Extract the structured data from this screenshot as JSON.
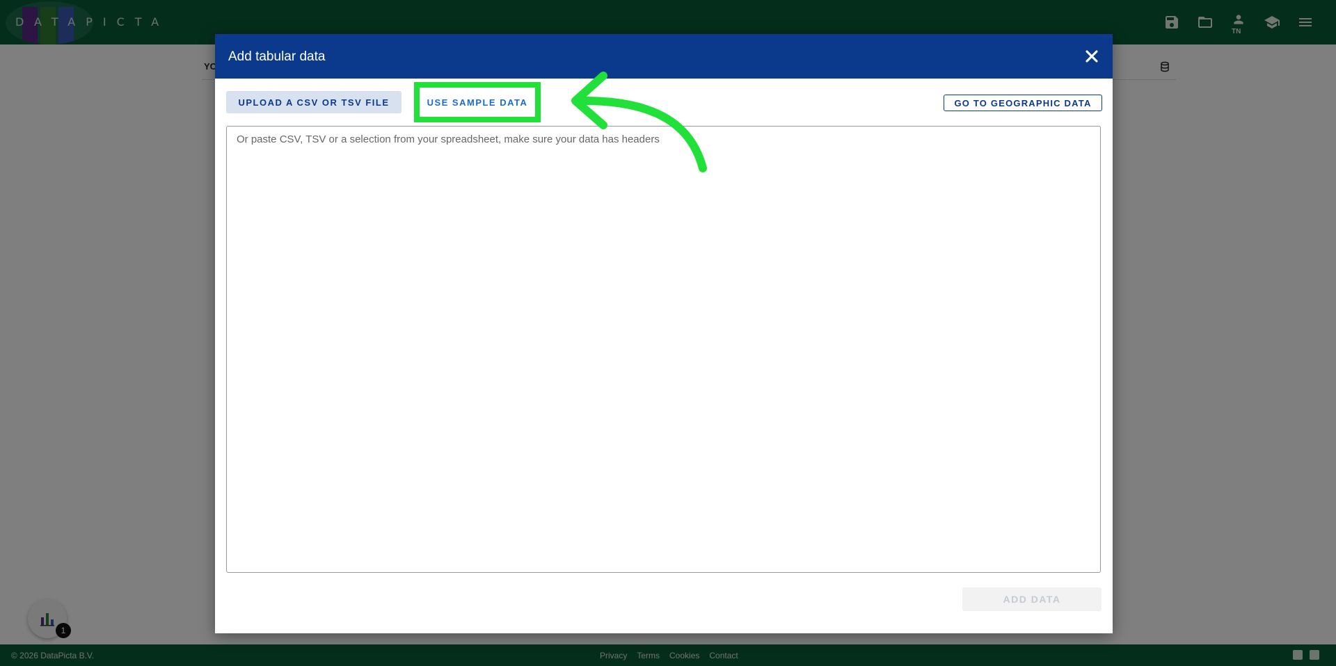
{
  "app": {
    "logo_text": "DATAPICTA",
    "logo_colors": [
      "#5b2a86",
      "#2f7d32",
      "#3b5bb5"
    ],
    "topbar_color": "#0a5a38",
    "user_initials": "TN",
    "top_icons": [
      "save-icon",
      "folder-open-icon",
      "account-icon",
      "school-icon",
      "menu-icon"
    ]
  },
  "page": {
    "partial_heading": "YO"
  },
  "modal": {
    "title": "Add tabular data",
    "header_color": "#0b3a8c",
    "upload_button": "UPLOAD A CSV OR TSV FILE",
    "sample_button": "USE SAMPLE DATA",
    "geo_button": "GO TO GEOGRAPHIC DATA",
    "paste_placeholder": "Or paste CSV, TSV or a selection from your spreadsheet, make sure your data has headers",
    "paste_value": "",
    "add_button": "ADD DATA"
  },
  "annotation": {
    "text": "Use Sample Data",
    "highlight_color": "#22e03a"
  },
  "widget": {
    "badge_count": "1"
  },
  "footer": {
    "copyright": "© 2026 DataPicta B.V.",
    "links": [
      "Privacy",
      "Terms",
      "Cookies",
      "Contact"
    ],
    "social": [
      "youtube-icon",
      "linkedin-icon"
    ]
  }
}
